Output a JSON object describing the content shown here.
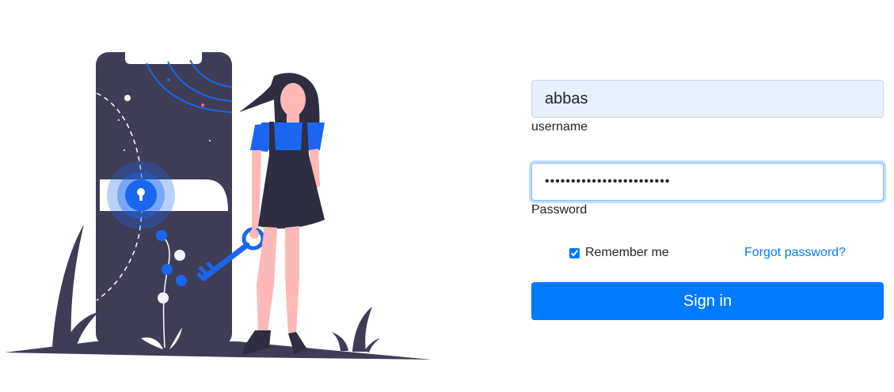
{
  "login": {
    "username_value": "abbas",
    "username_label": "username",
    "password_value": "••••••••••••••••••••••••",
    "password_label": "Password",
    "remember_label": "Remember me",
    "remember_checked": true,
    "forgot_label": "Forgot password?",
    "signin_label": "Sign in"
  },
  "colors": {
    "accent": "#007bff",
    "input_autofill": "#e8f0fe",
    "illustration_dark": "#3f3d56",
    "illustration_blue": "#1a66f0"
  },
  "illustration": {
    "icons": [
      "phone-lock-icon",
      "keyhole-icon",
      "key-icon",
      "woman-figure",
      "plant-icon"
    ]
  }
}
